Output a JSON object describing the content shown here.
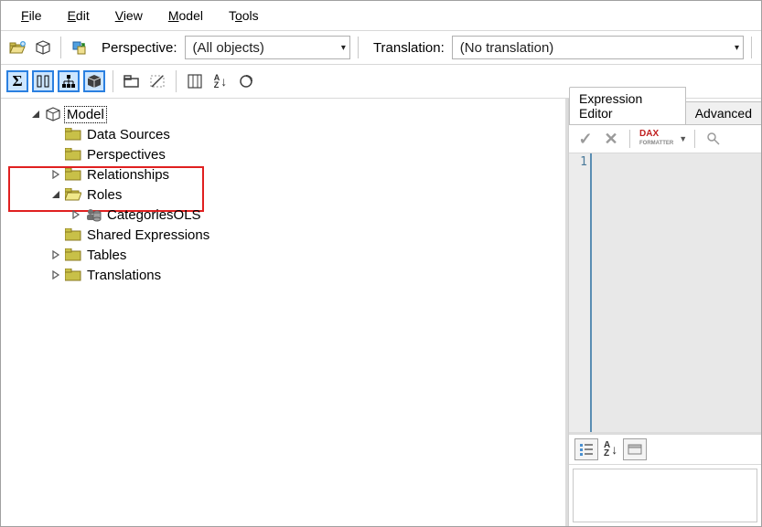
{
  "menu": {
    "file": "File",
    "edit": "Edit",
    "view": "View",
    "model": "Model",
    "tools": "Tools"
  },
  "toolbar1": {
    "perspective_label": "Perspective:",
    "perspective_value": "(All objects)",
    "translation_label": "Translation:",
    "translation_value": "(No translation)"
  },
  "tree": {
    "root": "Model",
    "items": [
      {
        "label": "Data Sources",
        "expander": "none"
      },
      {
        "label": "Perspectives",
        "expander": "none"
      },
      {
        "label": "Relationships",
        "expander": "closed"
      },
      {
        "label": "Roles",
        "expander": "open"
      },
      {
        "label": "CategoriesOLS",
        "expander": "closed",
        "child": true
      },
      {
        "label": "Shared Expressions",
        "expander": "none"
      },
      {
        "label": "Tables",
        "expander": "closed"
      },
      {
        "label": "Translations",
        "expander": "closed"
      }
    ]
  },
  "rightpanel": {
    "tabs": [
      "Expression Editor",
      "Advanced"
    ],
    "dax_label": "DAX",
    "line_number": "1"
  }
}
